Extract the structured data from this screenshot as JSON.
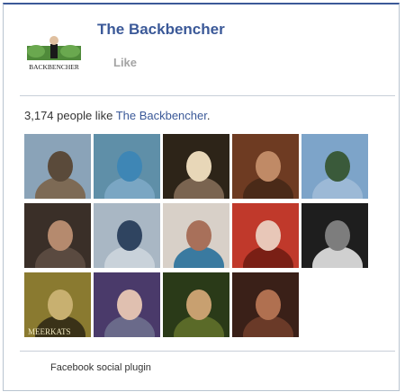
{
  "page": {
    "name": "The Backbencher",
    "like_label": "Like",
    "logo_text": "BACKBENCHER"
  },
  "fans": {
    "count_text": "3,174 people like ",
    "page_link": "The Backbencher",
    "suffix": ".",
    "faces": [
      {
        "name": "fan-1",
        "colors": [
          "#8aa3b8",
          "#5a4a3a",
          "#7d6a55"
        ]
      },
      {
        "name": "fan-2",
        "colors": [
          "#5f8fa8",
          "#3e86b5",
          "#7aa6c3"
        ]
      },
      {
        "name": "fan-3",
        "colors": [
          "#2d2418",
          "#e8d7b8",
          "#7a6450"
        ]
      },
      {
        "name": "fan-4",
        "colors": [
          "#6e3b22",
          "#c08a66",
          "#4a2a18"
        ]
      },
      {
        "name": "fan-5",
        "colors": [
          "#7da4c9",
          "#3a5a3a",
          "#9cb9d6"
        ]
      },
      {
        "name": "fan-6",
        "colors": [
          "#3a2f28",
          "#b58a6e",
          "#5a4a40"
        ]
      },
      {
        "name": "fan-7",
        "colors": [
          "#a9b7c4",
          "#2f4460",
          "#c9d2da"
        ]
      },
      {
        "name": "fan-8",
        "colors": [
          "#d8d0c8",
          "#a8705a",
          "#3a7aa0"
        ]
      },
      {
        "name": "fan-9",
        "colors": [
          "#c0392b",
          "#e8c7b8",
          "#7a1f15"
        ]
      },
      {
        "name": "fan-10",
        "colors": [
          "#1e1e1e",
          "#7d7d7d",
          "#d0d0d0"
        ]
      },
      {
        "name": "fan-11",
        "colors": [
          "#8a7a30",
          "#c8b070",
          "#3a3218"
        ]
      },
      {
        "name": "fan-12",
        "colors": [
          "#4a3a6a",
          "#e0c0b0",
          "#6a6a8a"
        ]
      },
      {
        "name": "fan-13",
        "colors": [
          "#2a3a18",
          "#c8a070",
          "#5a6a28"
        ]
      },
      {
        "name": "fan-14",
        "colors": [
          "#3a2018",
          "#b07050",
          "#6a3a28"
        ]
      }
    ],
    "meerkats_label": "MEERKATS"
  },
  "footer": {
    "label": "Facebook social plugin"
  },
  "colors": {
    "brand": "#3b5998",
    "like_gray": "#a4a4a4"
  }
}
